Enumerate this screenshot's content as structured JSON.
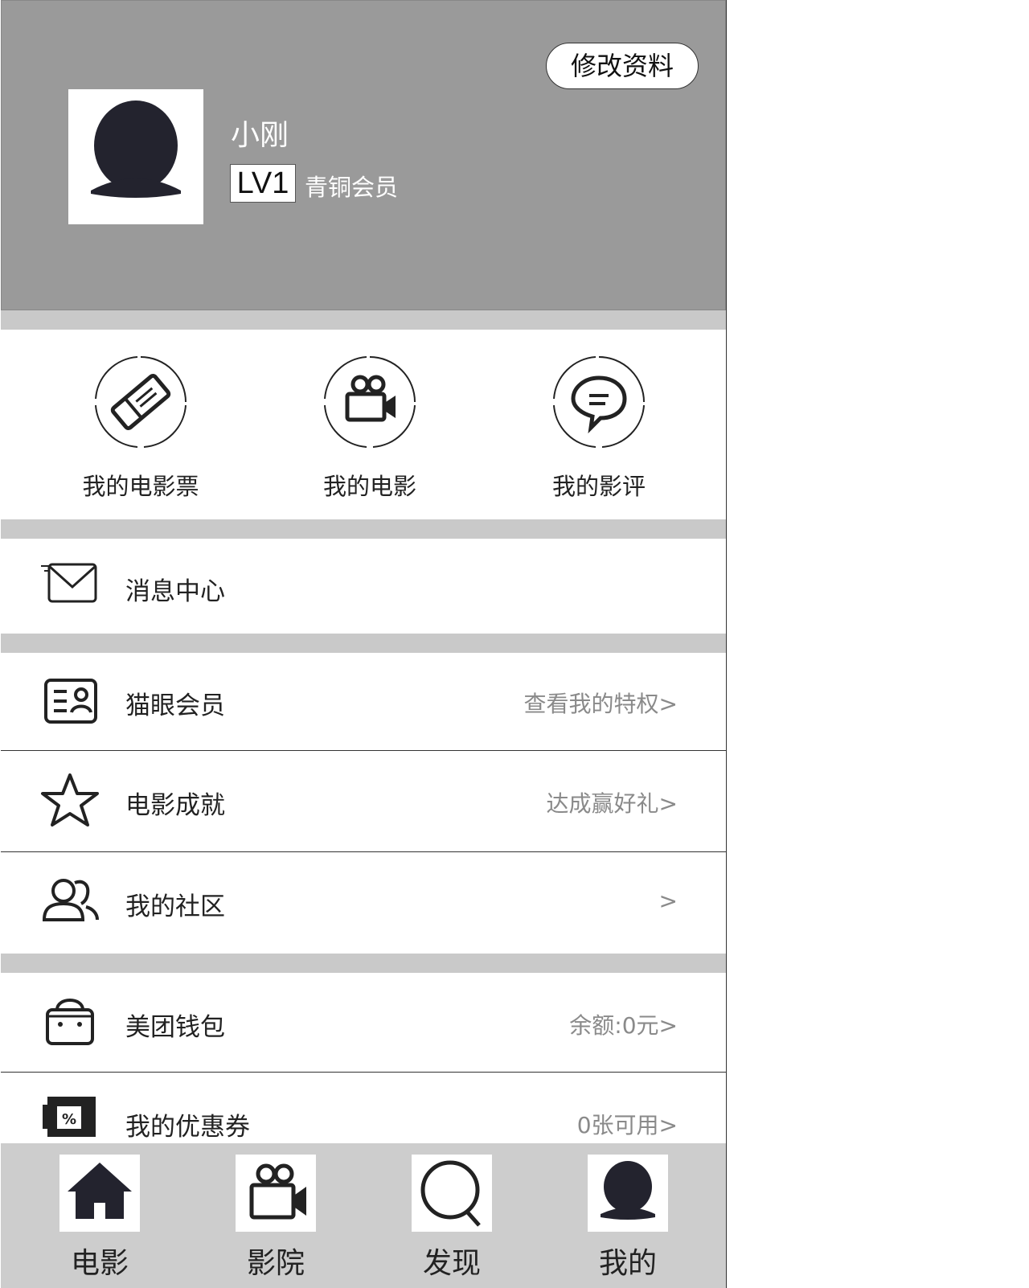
{
  "header": {
    "edit_label": "修改资料",
    "username": "小刚",
    "level": "LV1",
    "level_name": "青铜会员"
  },
  "shortcuts": [
    {
      "label": "我的电影票",
      "icon": "ticket-icon"
    },
    {
      "label": "我的电影",
      "icon": "movie-camera-icon"
    },
    {
      "label": "我的影评",
      "icon": "comment-icon"
    }
  ],
  "menu": {
    "messages": {
      "title": "消息中心",
      "icon": "mail-icon"
    },
    "membership": {
      "title": "猫眼会员",
      "extra": "查看我的特权>",
      "icon": "member-card-icon"
    },
    "achievements": {
      "title": "电影成就",
      "extra": "达成赢好礼>",
      "icon": "star-icon"
    },
    "community": {
      "title": "我的社区",
      "extra": ">",
      "icon": "users-icon"
    },
    "wallet": {
      "title": "美团钱包",
      "extra": "余额:0元>",
      "icon": "bag-icon"
    },
    "coupons": {
      "title": "我的优惠券",
      "extra": "0张可用>",
      "icon": "coupon-icon"
    }
  },
  "tabbar": [
    {
      "label": "电影",
      "icon": "home-icon"
    },
    {
      "label": "影院",
      "icon": "movie-camera-icon"
    },
    {
      "label": "发现",
      "icon": "search-icon"
    },
    {
      "label": "我的",
      "icon": "profile-icon"
    }
  ]
}
